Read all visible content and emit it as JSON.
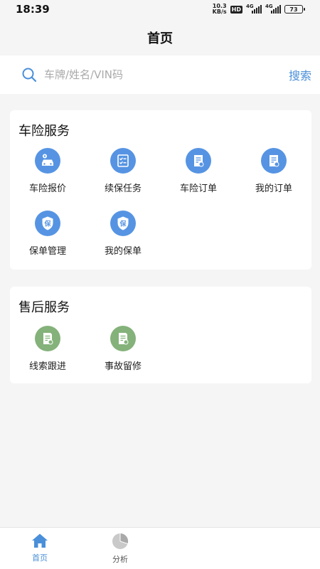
{
  "status_bar": {
    "time": "18:39",
    "net_speed_value": "10.3",
    "net_speed_unit": "KB/s",
    "hd_badge": "HD",
    "signal_1_label": "4G",
    "signal_2_label": "4G",
    "battery_level": "73"
  },
  "nav": {
    "title": "首页"
  },
  "search": {
    "placeholder": "车牌/姓名/VIN码",
    "value": "",
    "button_label": "搜索"
  },
  "sections": {
    "insurance": {
      "title": "车险服务",
      "items": [
        {
          "label": "车险报价",
          "icon": "car-quote-icon"
        },
        {
          "label": "续保任务",
          "icon": "checklist-icon"
        },
        {
          "label": "车险订单",
          "icon": "order-icon"
        },
        {
          "label": "我的订单",
          "icon": "order-icon"
        },
        {
          "label": "保单管理",
          "icon": "shield-icon",
          "icon_text": "保"
        },
        {
          "label": "我的保单",
          "icon": "shield-icon",
          "icon_text": "保"
        }
      ]
    },
    "aftersale": {
      "title": "售后服务",
      "items": [
        {
          "label": "线索跟进",
          "icon": "document-icon"
        },
        {
          "label": "事故留修",
          "icon": "document-icon"
        }
      ]
    }
  },
  "tabbar": {
    "home_label": "首页",
    "analysis_label": "分析"
  },
  "colors": {
    "accent_blue": "#4a8fd9",
    "icon_blue": "#5694e3",
    "icon_green": "#84b27a",
    "tab_inactive": "#b5b5b5",
    "page_bg": "#f5f5f5"
  }
}
